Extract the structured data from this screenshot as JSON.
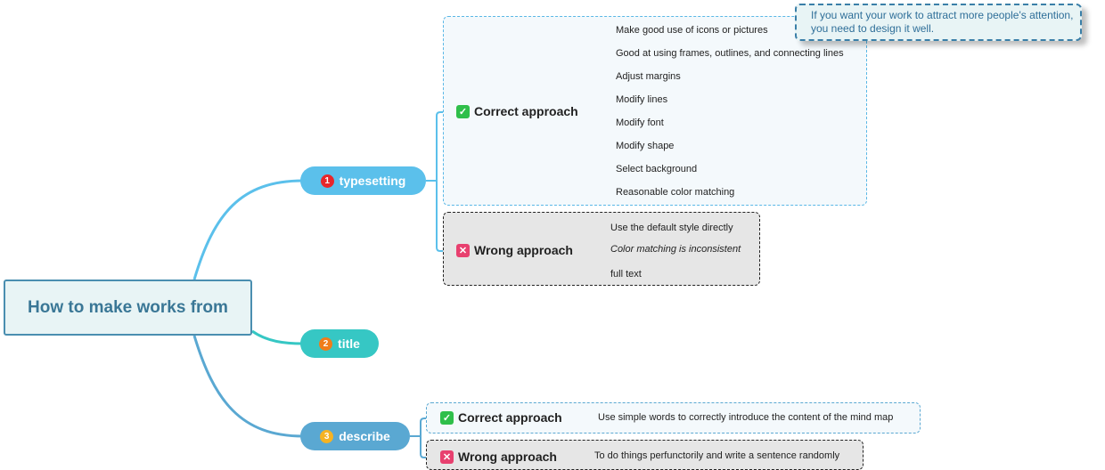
{
  "root": {
    "label": "How to make works from"
  },
  "branches": [
    {
      "number": "1",
      "label": "typesetting",
      "color": "#5bc0eb",
      "badge_color": "#e8262a"
    },
    {
      "number": "2",
      "label": "title",
      "color": "#36c7c4",
      "badge_color": "#f07d1a"
    },
    {
      "number": "3",
      "label": "describe",
      "color": "#5aa8d2",
      "badge_color": "#f5b323"
    }
  ],
  "typesetting": {
    "correct": {
      "icon": "check-icon",
      "label": "Correct approach",
      "items": [
        "Make good use of icons or pictures",
        "Good at using frames, outlines, and connecting lines",
        "Adjust margins",
        "Modify lines",
        "Modify font",
        "Modify shape",
        "Select background",
        "Reasonable color matching"
      ]
    },
    "wrong": {
      "icon": "cross-icon",
      "label": "Wrong approach",
      "items": [
        "Use the default style directly",
        "Color matching is inconsistent",
        "full text"
      ]
    },
    "callout": "If you want your work to attract more people's attention, you need to design it well."
  },
  "describe": {
    "correct": {
      "icon": "check-icon",
      "label": "Correct approach",
      "item": "Use simple words to correctly introduce the content of the mind map"
    },
    "wrong": {
      "icon": "cross-icon",
      "label": "Wrong approach",
      "item": "To do things perfunctorily and write a sentence randomly"
    }
  }
}
